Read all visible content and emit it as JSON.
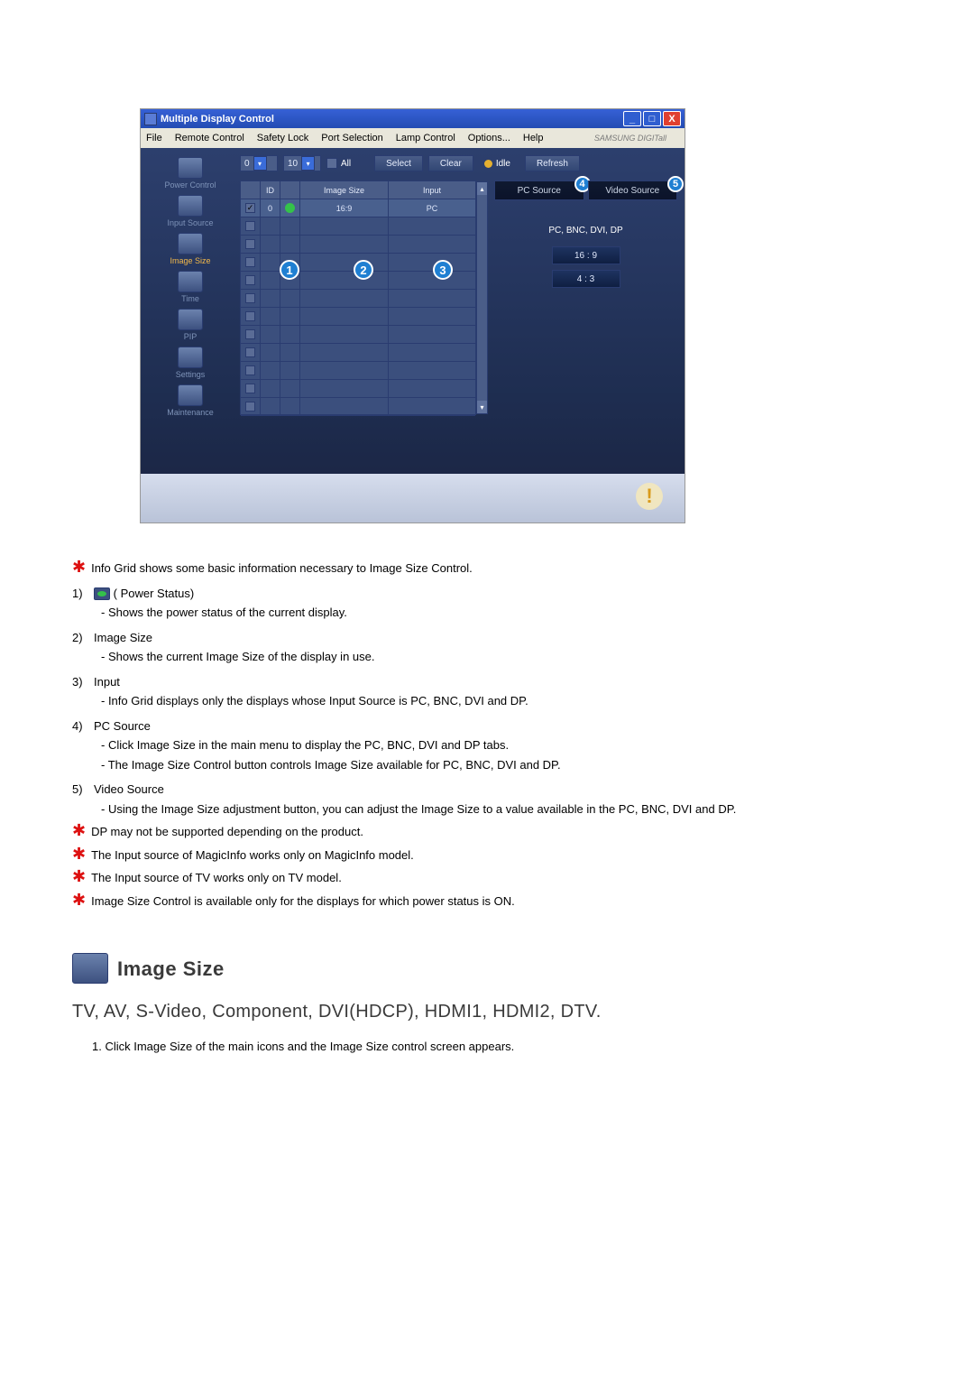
{
  "window": {
    "title": "Multiple Display Control",
    "menus": [
      "File",
      "Remote Control",
      "Safety Lock",
      "Port Selection",
      "Lamp Control",
      "Options...",
      "Help"
    ],
    "brand": "SAMSUNG DIGITall"
  },
  "toolbar": {
    "combo1": "0",
    "combo2": "10",
    "all_label": "All",
    "select": "Select",
    "clear": "Clear",
    "idle": "Idle",
    "refresh": "Refresh"
  },
  "sidebar": {
    "items": [
      {
        "label": "Power Control"
      },
      {
        "label": "Input Source"
      },
      {
        "label": "Image Size"
      },
      {
        "label": "Time"
      },
      {
        "label": "PIP"
      },
      {
        "label": "Settings"
      },
      {
        "label": "Maintenance"
      }
    ],
    "active_index": 2
  },
  "grid": {
    "headers": {
      "chk": "",
      "id": "ID",
      "power": "",
      "size": "Image Size",
      "input": "Input"
    },
    "row0": {
      "id": "0",
      "size": "16:9",
      "input": "PC"
    },
    "blank_rows": 11
  },
  "right_panel": {
    "tab_pc": "PC Source",
    "tab_video": "Video Source",
    "marker_pc": "4",
    "marker_video": "5",
    "title": "PC, BNC, DVI, DP",
    "ratio1": "16 : 9",
    "ratio2": "4 : 3"
  },
  "grid_markers": {
    "m1": "1",
    "m2": "2",
    "m3": "3"
  },
  "intro_star": "Info Grid shows some basic information necessary to Image Size Control.",
  "list": {
    "i1": {
      "n": "1)",
      "title_a": "",
      "title_b": "( Power Status)",
      "sub": "- Shows the power status of the current display."
    },
    "i2": {
      "n": "2)",
      "title": "Image Size",
      "sub": "- Shows the current Image Size of the display in use."
    },
    "i3": {
      "n": "3)",
      "title": "Input",
      "sub": "- Info Grid displays only the displays whose Input Source is PC, BNC, DVI and DP."
    },
    "i4": {
      "n": "4)",
      "title": "PC Source",
      "sub1": "- Click Image Size in the main menu to display the PC, BNC, DVI and DP tabs.",
      "sub2": "- The Image Size Control button controls Image Size available for PC, BNC, DVI and DP."
    },
    "i5": {
      "n": "5)",
      "title": "Video Source",
      "sub": "- Using the Image Size adjustment button, you can adjust the Image Size to a value available in the PC, BNC, DVI and DP."
    }
  },
  "notes": {
    "n1": "DP may not be supported depending on the product.",
    "n2": "The Input source of MagicInfo works only on MagicInfo model.",
    "n3": "The Input source of TV works only on TV model.",
    "n4": "Image Size Control is available only for the displays for which power status is ON."
  },
  "section": {
    "heading": "Image Size",
    "subheading": "TV, AV, S-Video, Component, DVI(HDCP), HDMI1, HDMI2, DTV.",
    "step1n": "1.",
    "step1": "Click Image Size of the main icons and the Image Size control screen appears."
  }
}
